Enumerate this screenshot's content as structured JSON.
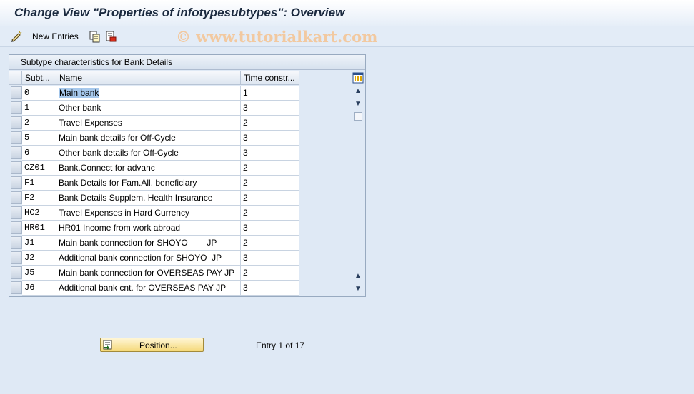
{
  "window": {
    "title": "Change View \"Properties of infotypesubtypes\": Overview"
  },
  "toolbar": {
    "new_entries_label": "New Entries"
  },
  "watermark": "© www.tutorialkart.com",
  "panel": {
    "title": "Subtype characteristics for Bank Details",
    "columns": [
      "Subt...",
      "Name",
      "Time constr..."
    ],
    "rows": [
      {
        "subtype": "0",
        "name": "Main bank",
        "time": "1"
      },
      {
        "subtype": "1",
        "name": "Other bank",
        "time": "3"
      },
      {
        "subtype": "2",
        "name": "Travel Expenses",
        "time": "2"
      },
      {
        "subtype": "5",
        "name": "Main bank details for Off-Cycle",
        "time": "3"
      },
      {
        "subtype": "6",
        "name": "Other bank details for Off-Cycle",
        "time": "3"
      },
      {
        "subtype": "CZ01",
        "name": "Bank.Connect for advanc",
        "time": "2"
      },
      {
        "subtype": "F1",
        "name": "Bank Details for Fam.All. beneficiary",
        "time": "2"
      },
      {
        "subtype": "F2",
        "name": "Bank Details Supplem. Health Insurance",
        "time": "2"
      },
      {
        "subtype": "HC2",
        "name": "Travel Expenses in Hard Currency",
        "time": "2"
      },
      {
        "subtype": "HR01",
        "name": "HR01 Income from work abroad",
        "time": "3"
      },
      {
        "subtype": "J1",
        "name": "Main bank connection for SHOYO        JP",
        "time": "2"
      },
      {
        "subtype": "J2",
        "name": "Additional bank connection for SHOYO  JP",
        "time": "3"
      },
      {
        "subtype": "J5",
        "name": "Main bank connection for OVERSEAS PAY JP",
        "time": "2"
      },
      {
        "subtype": "J6",
        "name": "Additional bank cnt. for OVERSEAS PAY JP",
        "time": "3"
      }
    ]
  },
  "footer": {
    "position_button_label": "Position...",
    "entry_text": "Entry 1 of 17"
  },
  "icons": {
    "new_entries": "pencil-new-icon",
    "copy": "copy-icon",
    "delete": "delete-icon",
    "table_settings": "table-settings-icon",
    "position": "position-icon"
  }
}
